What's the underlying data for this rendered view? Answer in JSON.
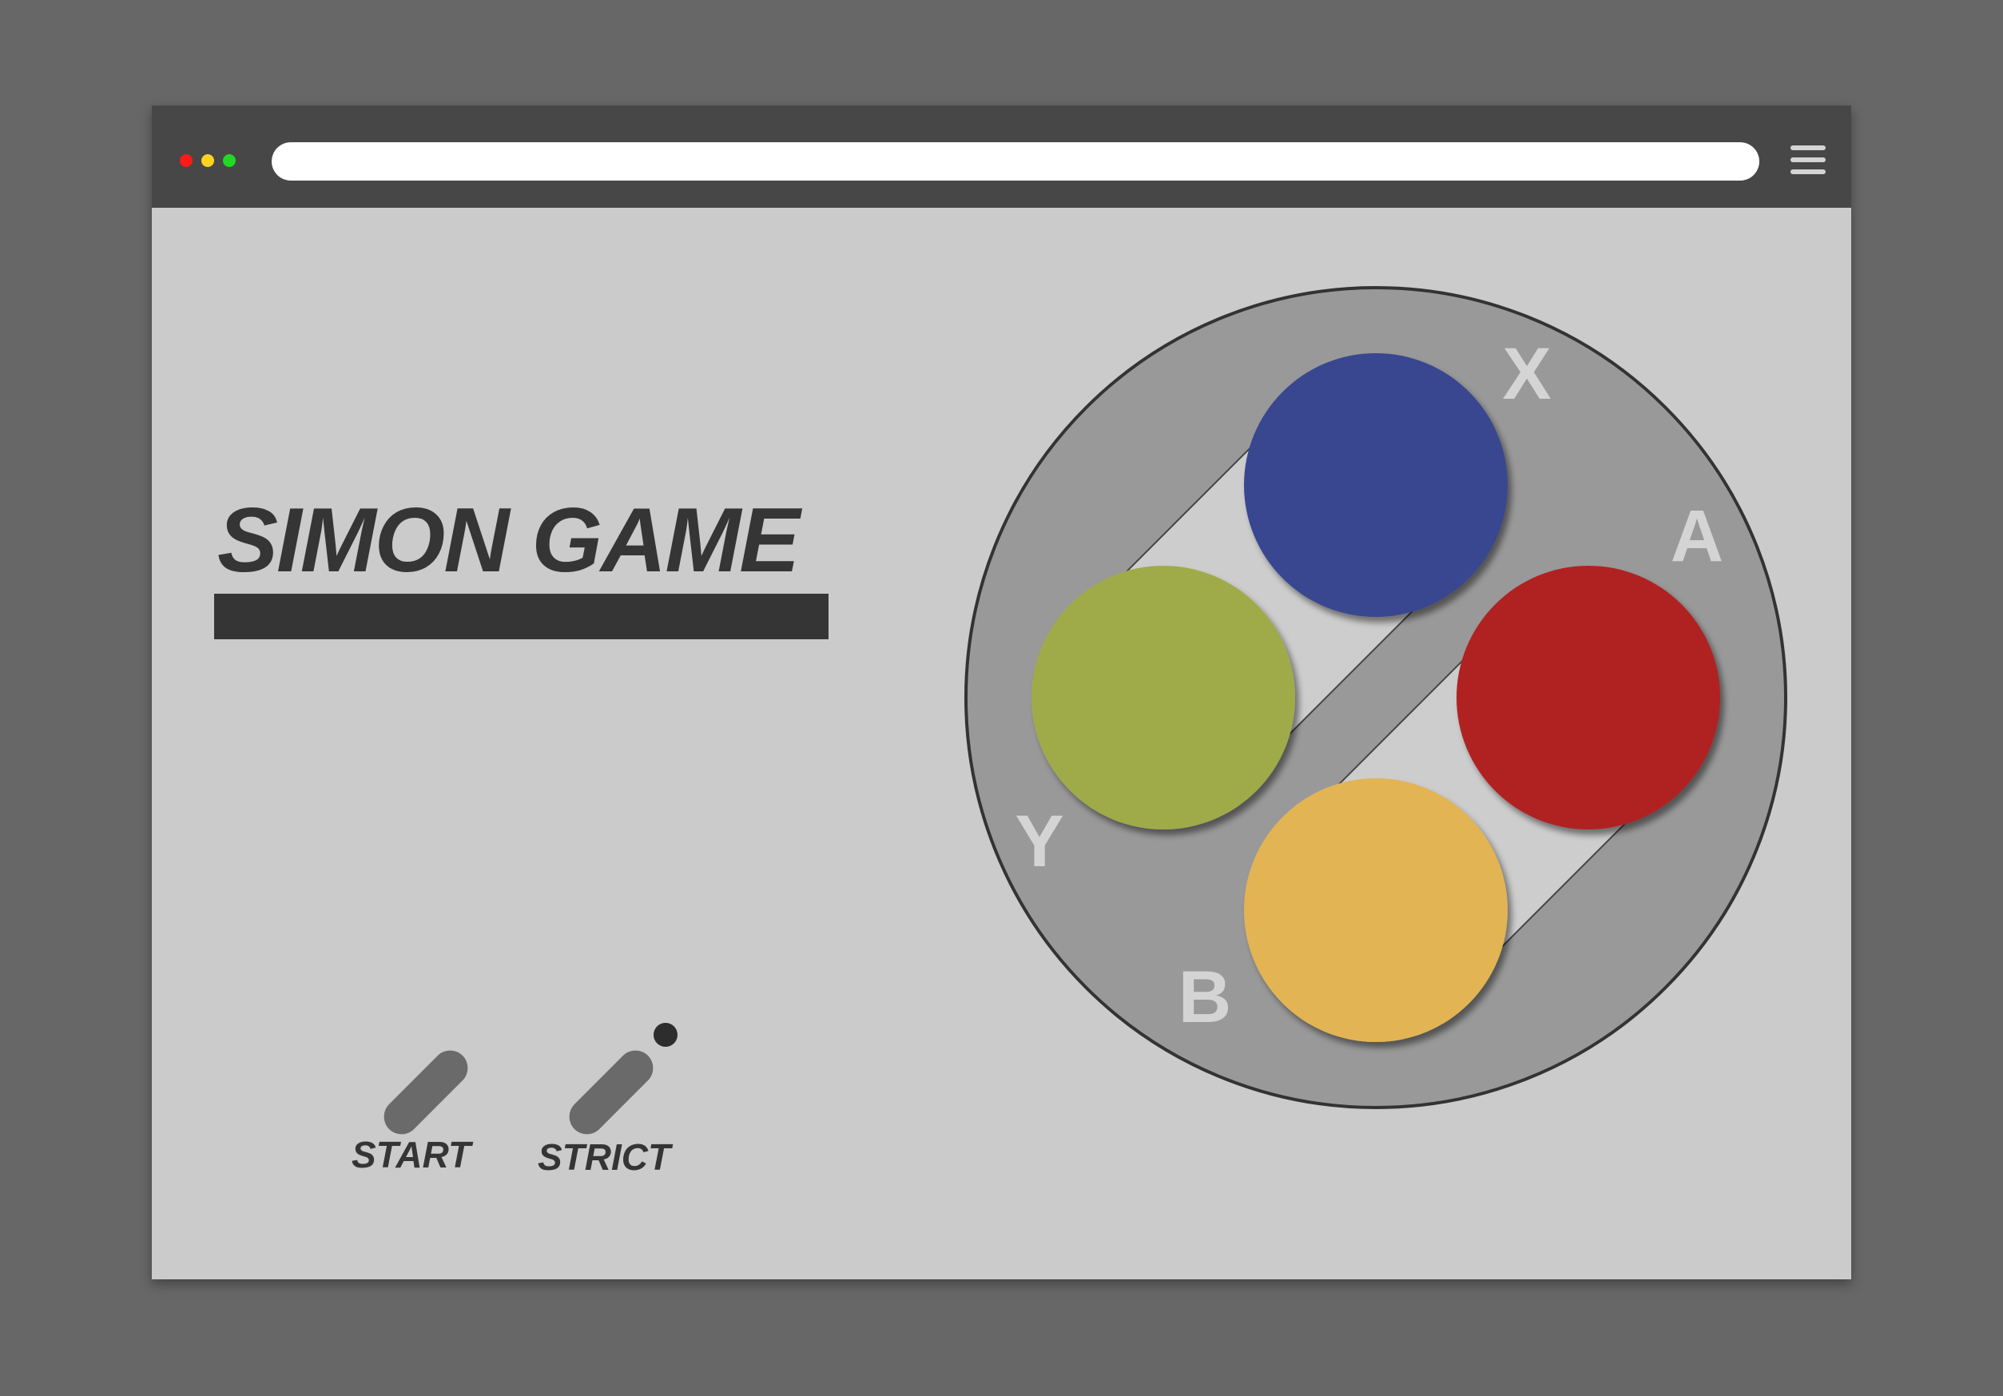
{
  "browser": {
    "window_dots": [
      {
        "name": "close",
        "color": "#ff1a1a"
      },
      {
        "name": "minimize",
        "color": "#ffd21f"
      },
      {
        "name": "maximize",
        "color": "#22d822"
      }
    ],
    "url": "",
    "menu_icon": "hamburger-menu-icon"
  },
  "game": {
    "title": "SIMON GAME",
    "controls": {
      "start_label": "START",
      "strict_label": "STRICT"
    },
    "buttons": {
      "x": {
        "letter": "X",
        "color": "#39468f"
      },
      "a": {
        "letter": "A",
        "color": "#b02121"
      },
      "y": {
        "letter": "Y",
        "color": "#9fab4a"
      },
      "b": {
        "letter": "B",
        "color": "#e2b452"
      }
    }
  },
  "colors": {
    "background": "#676767",
    "titlebar": "#474747",
    "content": "#cbcbcb",
    "text": "#353535",
    "pad_ring": "#999999",
    "switch": "#6a6a6a"
  }
}
